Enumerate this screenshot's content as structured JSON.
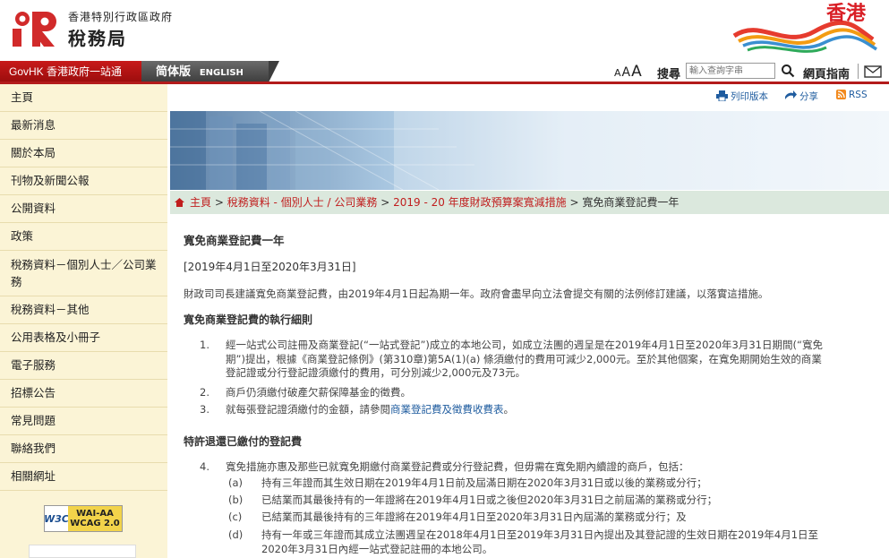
{
  "header": {
    "dept_top": "香港特別行政區政府",
    "dept_name": "稅務局",
    "brand_text": "香港"
  },
  "topbar": {
    "govhk": "GovHK 香港政府一站通",
    "lang_sc": "简体版",
    "lang_en": "ENGLISH",
    "font_small": "A",
    "font_medium": "A",
    "font_large": "A",
    "search_label": "搜尋",
    "search_placeholder": "輸入查詢字串",
    "sitemap": "網頁指南"
  },
  "sidebar": {
    "items": [
      "主頁",
      "最新消息",
      "關於本局",
      "刊物及新聞公報",
      "公開資料",
      "政策",
      "稅務資料－個別人士／公司業務",
      "稅務資料－其他",
      "公用表格及小冊子",
      "電子服務",
      "招標公告",
      "常見問題",
      "聯絡我們",
      "相關網址"
    ],
    "w3c": "W3C",
    "wcag_level": "WAI-AA",
    "wcag_version": "WCAG 2.0"
  },
  "tools": {
    "print": "列印版本",
    "share": "分享",
    "rss": "RSS"
  },
  "breadcrumb": {
    "home": "主頁",
    "level1": "稅務資料 - 個別人士 / 公司業務",
    "level2": "2019 - 20 年度財政預算案寬減措施",
    "current": "寬免商業登記費一年",
    "separator": ">"
  },
  "content": {
    "title": "寬免商業登記費一年",
    "period": "[2019年4月1日至2020年3月31日]",
    "intro": "財政司司長建議寬免商業登記費，由2019年4月1日起為期一年。政府會盡早向立法會提交有關的法例修訂建議，以落實這措施。",
    "section1_heading": "寬免商業登記費的執行細則",
    "item1_num": "1.",
    "item1_line1": "經一站式公司註冊及商業登記(“一站式登記”)成立的本地公司，如成立法團的週呈是在2019年4月1日至2020年3月31日期間(“寬免",
    "item1_line2": "期”)提出，根據《商業登記條例》(第310章)第5A(1)(a) 條須繳付的費用可減少2,000元。至於其他個案，在寬免期開始生效的商業",
    "item1_line3": "登記證或分行登記證須繳付的費用，可分別減少2,000元及73元。",
    "item2_num": "2.",
    "item2_text": "商戶仍須繳付破產欠薪保障基金的徵費。",
    "item3_num": "3.",
    "item3_prefix": "就每張登記證須繳付的金額，請參閱",
    "item3_link": "商業登記費及徵費收費表",
    "item3_suffix": "。",
    "section2_heading": "特許退還已繳付的登記費",
    "item4_num": "4.",
    "item4_text": "寬免措施亦惠及那些已就寬免期繳付商業登記費或分行登記費，但毋需在寬免期內續證的商戶，包括：",
    "sub_a_label": "(a)",
    "sub_a_text": "持有三年證而其生效日期在2019年4月1日前及屆滿日期在2020年3月31日或以後的業務或分行；",
    "sub_b_label": "(b)",
    "sub_b_text": "已結業而其最後持有的一年證將在2019年4月1日或之後但2020年3月31日之前屆滿的業務或分行；",
    "sub_c_label": "(c)",
    "sub_c_text": "已結業而其最後持有的三年證將在2019年4月1日至2020年3月31日內屆滿的業務或分行；及",
    "sub_d_label": "(d)",
    "sub_d_line1": "持有一年或三年證而其成立法團週呈在2018年4月1日至2019年3月31日內提出及其登記證的生效日期在2019年4月1日至",
    "sub_d_line2": "2020年3月31日內經一站式登記註冊的本地公司。"
  },
  "colors": {
    "brand_red": "#b31b1b",
    "sidebar_bg": "#fbf4d6",
    "breadcrumb_bg": "#dbe8dd",
    "link_blue": "#1f5c9f"
  }
}
